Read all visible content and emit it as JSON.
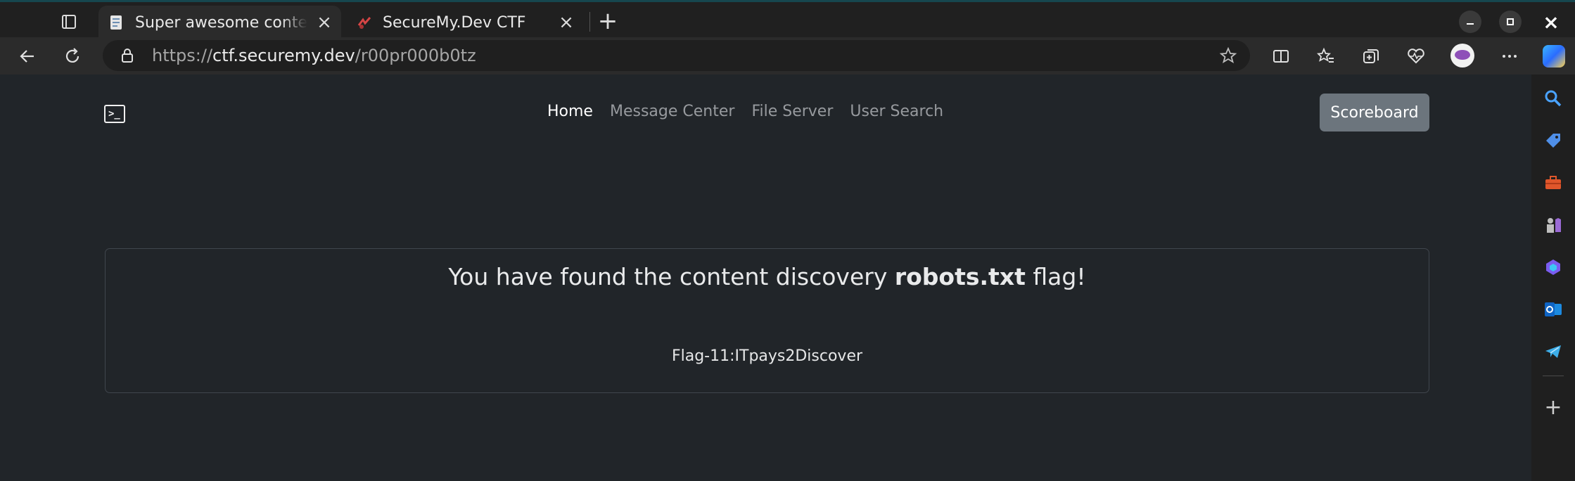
{
  "browser": {
    "tabs": [
      {
        "title": "Super awesome content discovery",
        "active": true
      },
      {
        "title": "SecureMy.Dev CTF",
        "active": false
      }
    ],
    "address": {
      "scheme": "https://",
      "host": "ctf.securemy.dev",
      "path": "/r00pr000b0tz"
    },
    "icons": {
      "back": "back-arrow-icon",
      "refresh": "refresh-icon",
      "lock": "lock-icon",
      "favorite": "star-icon",
      "split_screen": "split-screen-icon",
      "favorites": "favorites-icon",
      "collections": "collections-icon",
      "performance": "heart-pulse-icon",
      "more": "more-icon"
    },
    "sidebar": [
      "search-icon",
      "shopping-tag-icon",
      "tools-icon",
      "games-icon",
      "microsoft-365-icon",
      "outlook-icon",
      "telegram-icon"
    ],
    "accent": "#16474f"
  },
  "page": {
    "nav": {
      "items": [
        {
          "label": "Home",
          "active": true
        },
        {
          "label": "Message Center",
          "active": false
        },
        {
          "label": "File Server",
          "active": false
        },
        {
          "label": "User Search",
          "active": false
        }
      ],
      "scoreboard_label": "Scoreboard"
    },
    "card": {
      "title_prefix": "You have found the content discovery ",
      "title_bold": "robots.txt",
      "title_suffix": " flag!",
      "flag_text": "Flag-11:ITpays2Discover"
    },
    "colors": {
      "background": "#212529",
      "button": "#6c757d",
      "border": "#40464d"
    }
  }
}
